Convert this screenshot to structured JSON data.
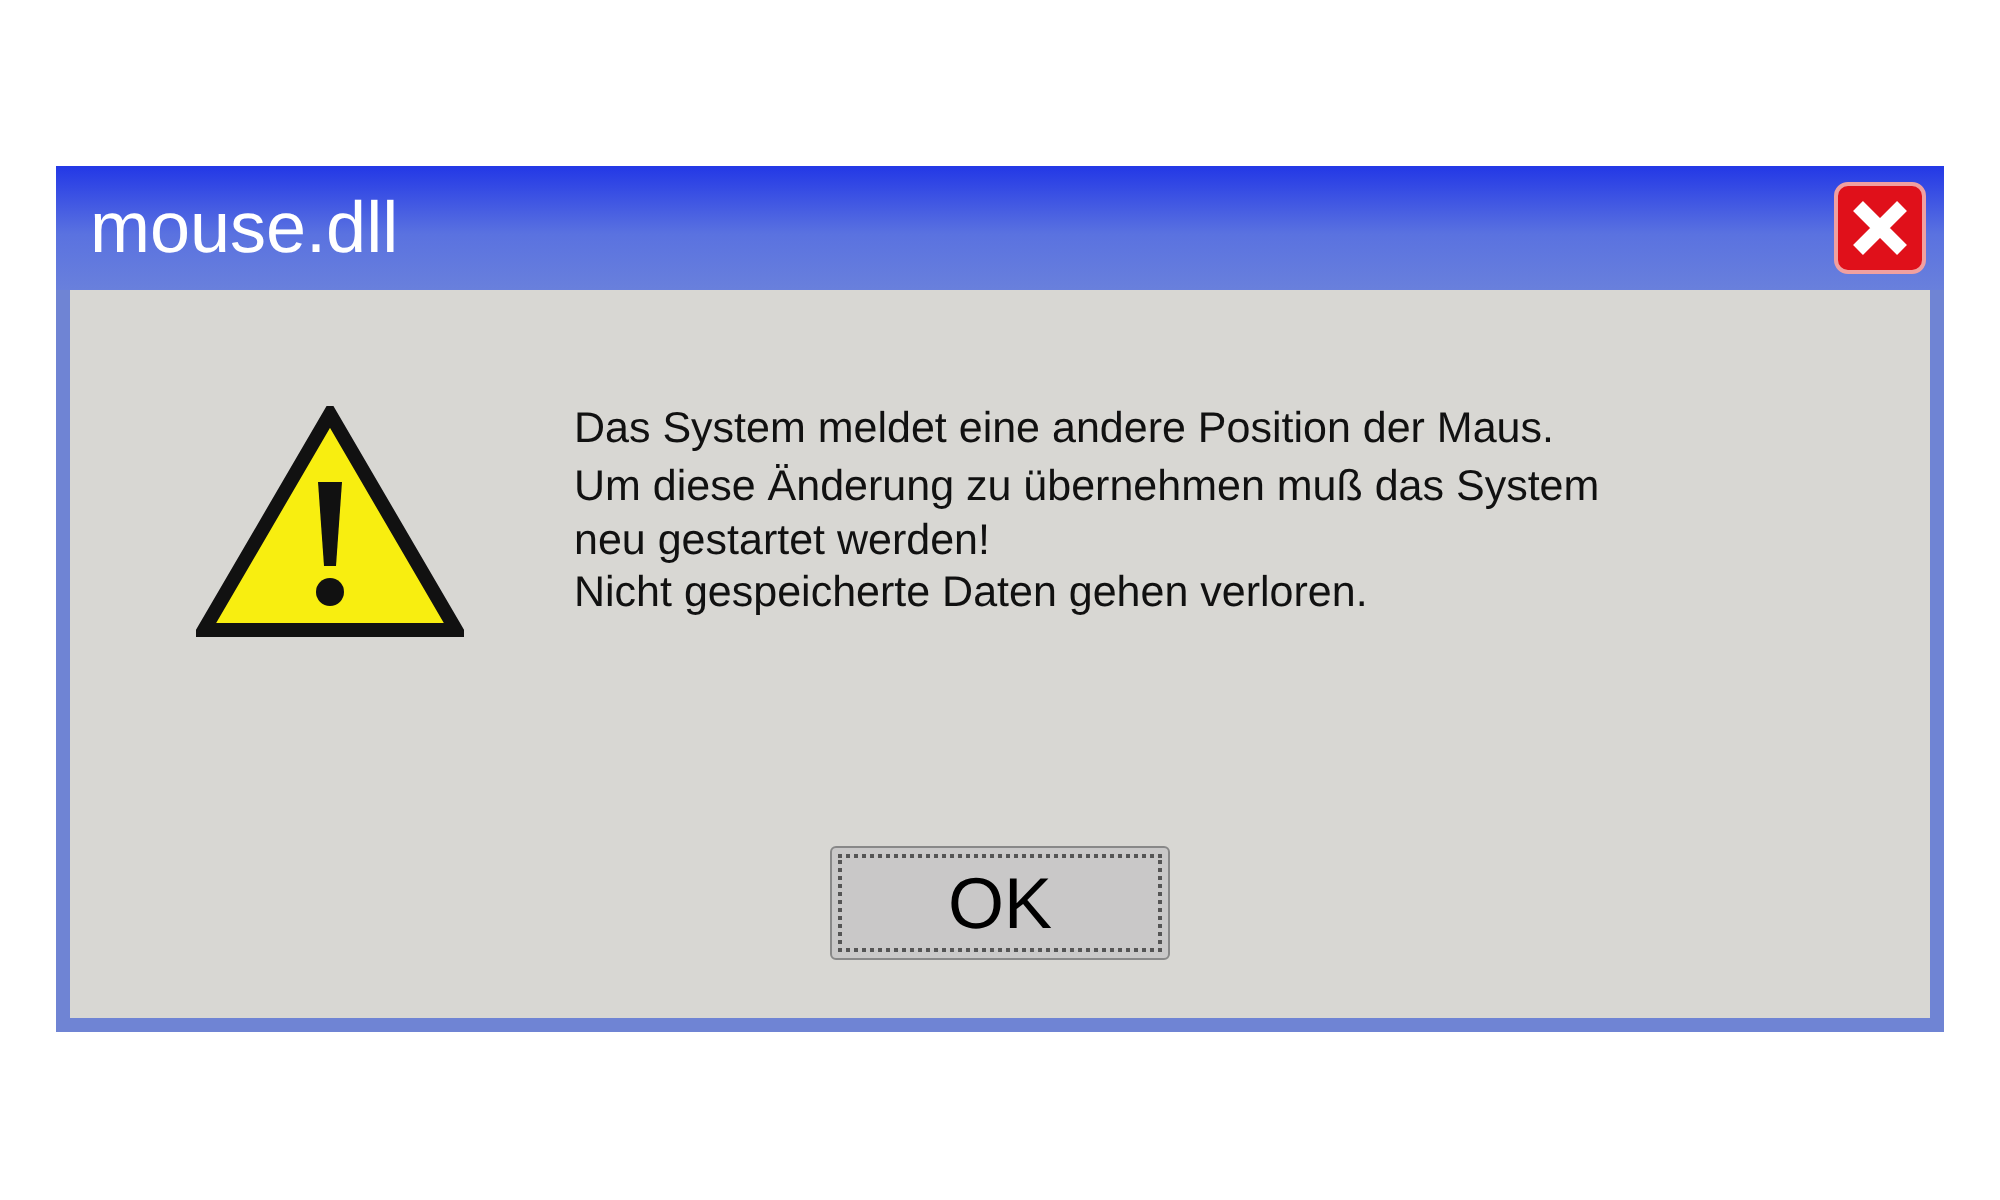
{
  "window": {
    "title": "mouse.dll"
  },
  "message": {
    "lines": [
      "Das System meldet eine andere Position der Maus.",
      "Um diese Änderung zu übernehmen muß das System",
      "neu gestartet werden!",
      "Nicht gespeicherte Daten gehen verloren."
    ]
  },
  "buttons": [
    {
      "label": "OK",
      "focused": true
    }
  ]
}
